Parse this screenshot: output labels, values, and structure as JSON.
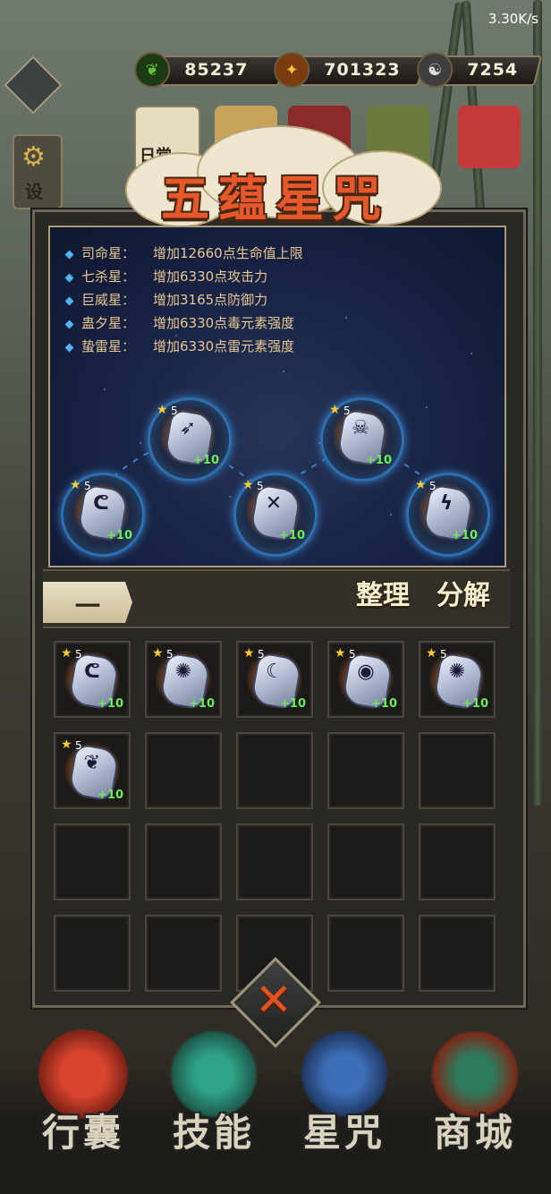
{
  "status": {
    "net_speed": "3.30K/s"
  },
  "resources": [
    {
      "icon": "jade-icon",
      "value": "85237",
      "color": "#6cc23a"
    },
    {
      "icon": "gold-coin-icon",
      "value": "701323",
      "color": "#f2a72a"
    },
    {
      "icon": "yin-yang-icon",
      "value": "7254",
      "color": "#d8d4cc"
    }
  ],
  "background_labels": {
    "daily": "日常",
    "settings": "设"
  },
  "panel": {
    "title": "五蕴星咒"
  },
  "bonuses": [
    {
      "name": "司命星：",
      "text": "增加12660点生命值上限"
    },
    {
      "name": "七杀星：",
      "text": "增加6330点攻击力"
    },
    {
      "name": "巨威星：",
      "text": "增加3165点防御力"
    },
    {
      "name": "蛊夕星：",
      "text": "增加6330点毒元素强度"
    },
    {
      "name": "蛰雷星：",
      "text": "增加6330点雷元素强度"
    }
  ],
  "equipped_runes": [
    {
      "slot": "司命星",
      "level": "5",
      "plus": "+10",
      "glyph": "ᕦ"
    },
    {
      "slot": "七杀星",
      "level": "5",
      "plus": "+10",
      "glyph": "➶"
    },
    {
      "slot": "巨威星",
      "level": "5",
      "plus": "+10",
      "glyph": "✕"
    },
    {
      "slot": "蛊夕星",
      "level": "5",
      "plus": "+10",
      "glyph": "☠"
    },
    {
      "slot": "蛰雷星",
      "level": "5",
      "plus": "+10",
      "glyph": "ϟ"
    }
  ],
  "toolbar": {
    "tab_label": "一",
    "sort_label": "整理",
    "decompose_label": "分解"
  },
  "inventory": [
    {
      "level": "5",
      "plus": "+10",
      "glyph": "ᕦ"
    },
    {
      "level": "5",
      "plus": "+10",
      "glyph": "✺"
    },
    {
      "level": "5",
      "plus": "+10",
      "glyph": "☾"
    },
    {
      "level": "5",
      "plus": "+10",
      "glyph": "◉"
    },
    {
      "level": "5",
      "plus": "+10",
      "glyph": "✺"
    },
    {
      "level": "5",
      "plus": "+10",
      "glyph": "❦"
    }
  ],
  "inventory_capacity": 20,
  "close_label": "✕",
  "bottom_nav": [
    {
      "label": "行囊",
      "icon": "bag-icon"
    },
    {
      "label": "技能",
      "icon": "skill-blade-icon"
    },
    {
      "label": "星咒",
      "icon": "star-scroll-icon"
    },
    {
      "label": "商城",
      "icon": "shop-icon"
    }
  ]
}
